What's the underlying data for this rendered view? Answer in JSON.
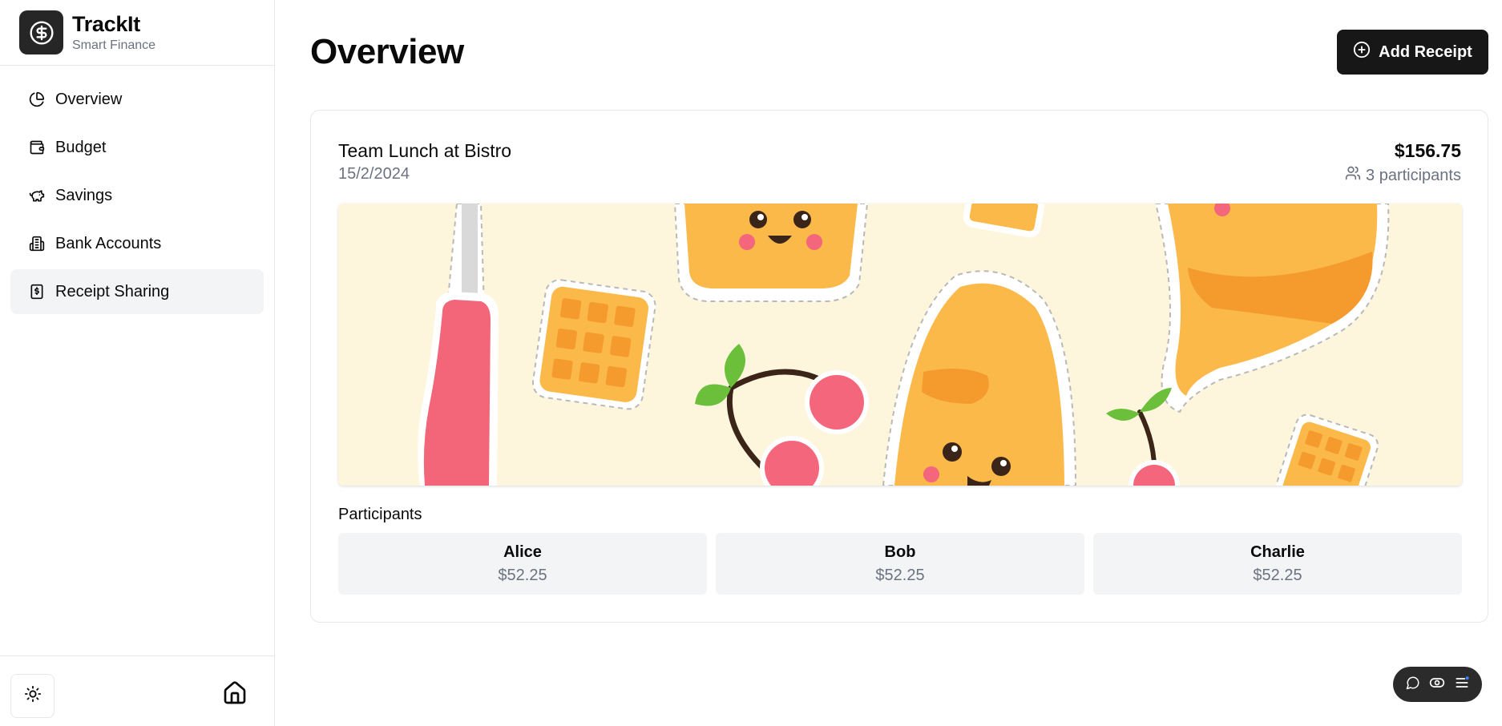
{
  "brand": {
    "title": "TrackIt",
    "subtitle": "Smart Finance"
  },
  "sidebar": {
    "items": [
      {
        "label": "Overview",
        "icon": "pie-chart-icon"
      },
      {
        "label": "Budget",
        "icon": "wallet-icon"
      },
      {
        "label": "Savings",
        "icon": "piggy-bank-icon"
      },
      {
        "label": "Bank Accounts",
        "icon": "bank-building-icon"
      },
      {
        "label": "Receipt Sharing",
        "icon": "receipt-icon",
        "active": true
      }
    ]
  },
  "page": {
    "title": "Overview",
    "add_button_label": "Add Receipt"
  },
  "receipt": {
    "title": "Team Lunch at Bistro",
    "date": "15/2/2024",
    "amount": "$156.75",
    "participants_count": "3 participants",
    "participants_heading": "Participants",
    "participants": [
      {
        "name": "Alice",
        "amount": "$52.25"
      },
      {
        "name": "Bob",
        "amount": "$52.25"
      },
      {
        "name": "Charlie",
        "amount": "$52.25"
      }
    ]
  },
  "colors": {
    "primary": "#171717",
    "active_bg": "#f3f4f6",
    "muted_text": "#6b7280",
    "border": "#e5e7eb"
  }
}
